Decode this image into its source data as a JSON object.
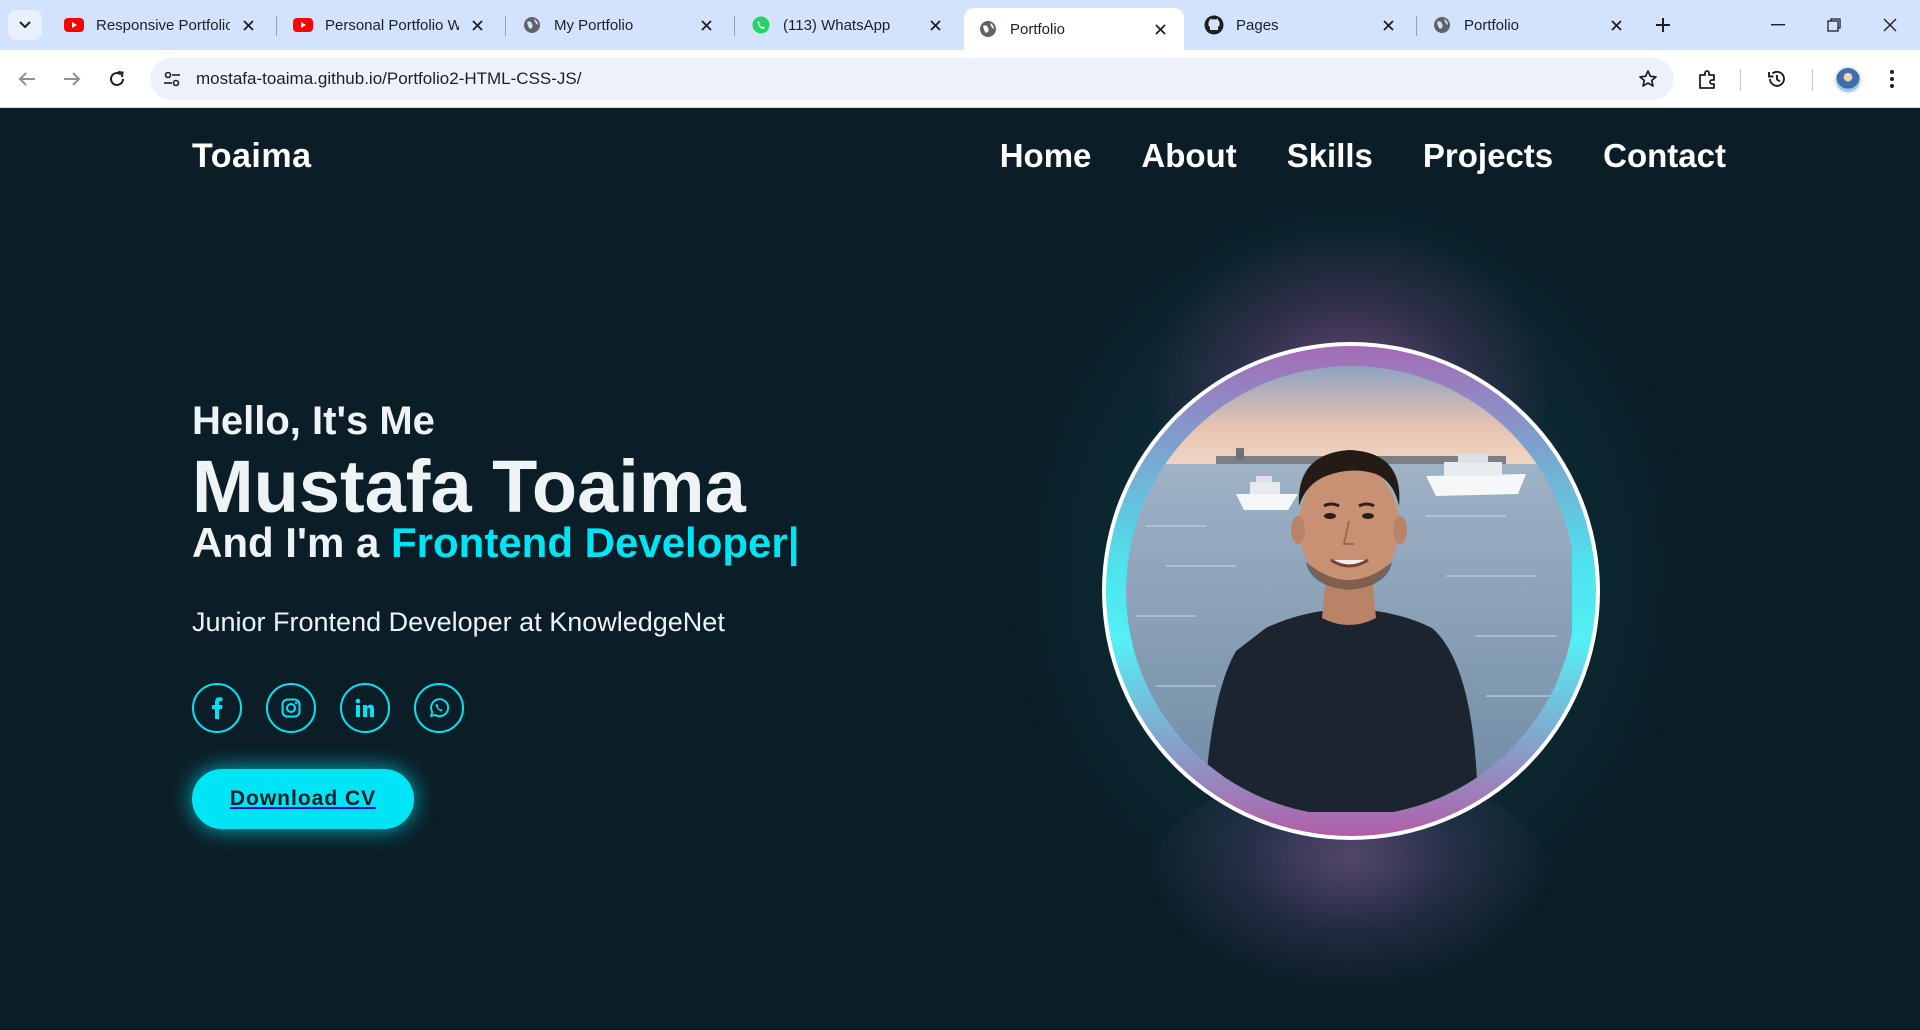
{
  "browser": {
    "tabs": [
      {
        "title": "Responsive Portfolio",
        "favicon": "youtube-icon"
      },
      {
        "title": "Personal Portfolio We",
        "favicon": "youtube-icon"
      },
      {
        "title": "My Portfolio",
        "favicon": "globe-icon"
      },
      {
        "title": "(113) WhatsApp",
        "favicon": "whatsapp-icon"
      },
      {
        "title": "Portfolio",
        "favicon": "globe-icon",
        "active": true
      },
      {
        "title": "Pages",
        "favicon": "github-icon"
      },
      {
        "title": "Portfolio",
        "favicon": "globe-icon"
      }
    ],
    "url": "mostafa-toaima.github.io/Portfolio2-HTML-CSS-JS/"
  },
  "site": {
    "logo": "Toaima",
    "nav": [
      "Home",
      "About",
      "Skills",
      "Projects",
      "Contact"
    ],
    "hero": {
      "greeting": "Hello, It's Me",
      "name": "Mustafa Toaima",
      "role_prefix": "And I'm a",
      "role_highlight": "Frontend Developer",
      "caret": "|",
      "subtitle": "Junior Frontend Developer at KnowledgeNet",
      "socials": [
        "facebook-icon",
        "instagram-icon",
        "linkedin-icon",
        "whatsapp-icon"
      ],
      "cta": "Download CV"
    },
    "colors": {
      "background": "#0b1e27",
      "accent": "#00e5f5",
      "glow_pink": "#a66bb5"
    }
  }
}
